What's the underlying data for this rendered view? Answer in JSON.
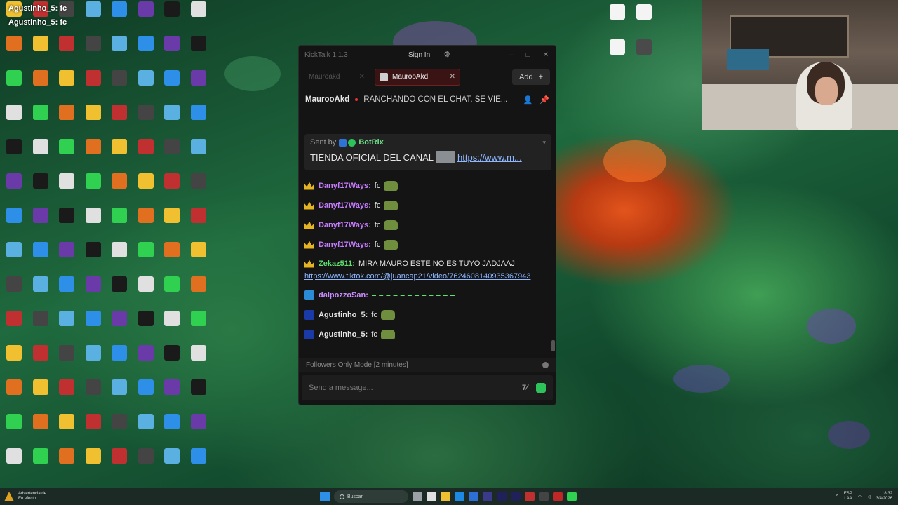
{
  "overlay": {
    "name_top": "Agustinho_5: fc",
    "name_bottom": "Agustinho_5: fc"
  },
  "window": {
    "title": "KickTalk 1.1.3",
    "sign_in": "Sign In",
    "tabs": [
      {
        "label": "Mauroakd",
        "active": false
      },
      {
        "label": "MaurooAkd",
        "active": true
      }
    ],
    "add_label": "Add",
    "stream": {
      "channel": "MaurooAkd",
      "title": "RANCHANDO CON EL CHAT. SE VIE..."
    },
    "pinned": {
      "sent_by": "Sent by",
      "bot": "BotRix",
      "text": "TIENDA OFICIAL DEL CANAL",
      "link": "https://www.m..."
    },
    "messages": [
      {
        "user": "Danyf17Ways:",
        "text": "fc",
        "style": "p",
        "badge": "crown"
      },
      {
        "user": "Danyf17Ways:",
        "text": "fc",
        "style": "p",
        "badge": "crown"
      },
      {
        "user": "Danyf17Ways:",
        "text": "fc",
        "style": "p",
        "badge": "crown"
      },
      {
        "user": "Danyf17Ways:",
        "text": "fc",
        "style": "p",
        "badge": "crown"
      }
    ],
    "long_message": {
      "user": "Zekaz511:",
      "text": "MIRA MAURO ESTE NO ES TUYO JADJAAJ",
      "url": "https://www.tiktok.com/@juancap21/video/7624608140935367943"
    },
    "spam_message": {
      "user": "dalpozzoSan:"
    },
    "messages2": [
      {
        "user": "Agustinho_5:",
        "text": "fc"
      },
      {
        "user": "Agustinho_5:",
        "text": "fc"
      }
    ],
    "mode_text": "Followers Only Mode [2 minutes]",
    "input_placeholder": "Send a message..."
  },
  "taskbar": {
    "warning_line1": "Advertencia de t...",
    "warning_line2": "En efecto",
    "search": "Buscar",
    "lang_line1": "ESP",
    "lang_line2": "LAA",
    "time": "18:32",
    "date": "3/4/2026"
  },
  "colors": {
    "accent": "#6b2222",
    "bot": "#6ee58a",
    "link": "#8fb7ff"
  }
}
